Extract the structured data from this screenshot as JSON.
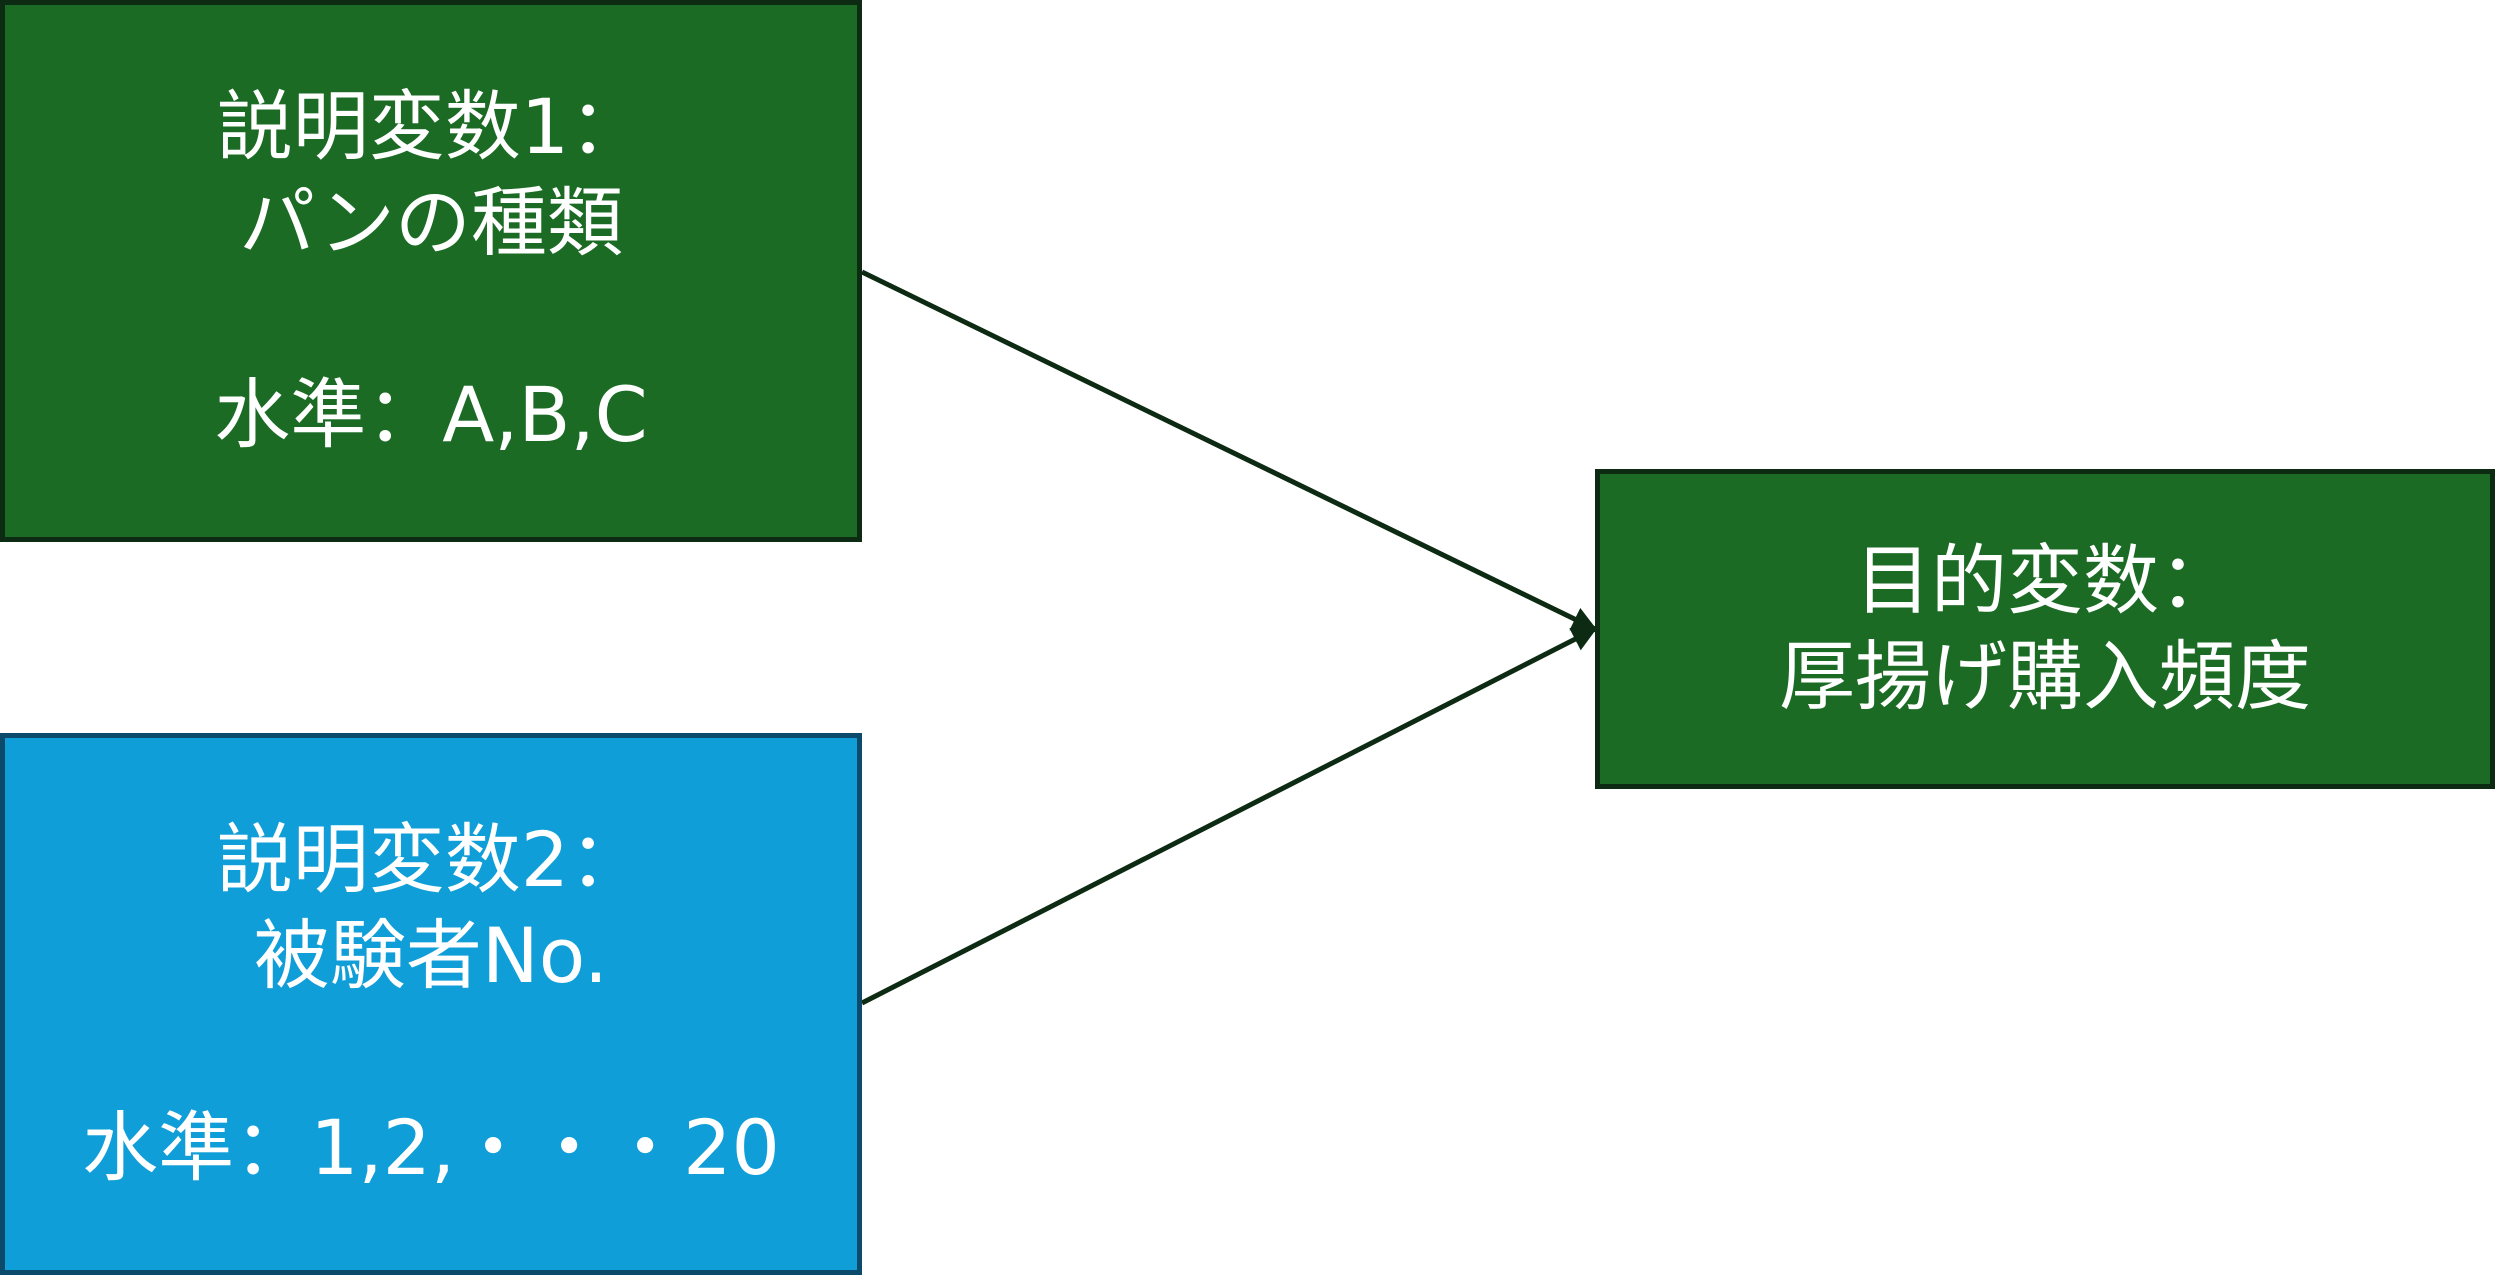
{
  "explanatory_1": {
    "title_line1": "説明変数1：",
    "title_line2": "パンの種類",
    "levels": "水準：A,B,C"
  },
  "explanatory_2": {
    "title_line1": "説明変数2：",
    "title_line2": "被験者No.",
    "levels": "水準：1,2,・・・20"
  },
  "target": {
    "title_line1": "目的変数：",
    "title_line2": "厚揚げ購入頻度"
  },
  "colors": {
    "green_box": "#1b6b25",
    "blue_box": "#109ed8",
    "arrow": "#0d2a12"
  }
}
